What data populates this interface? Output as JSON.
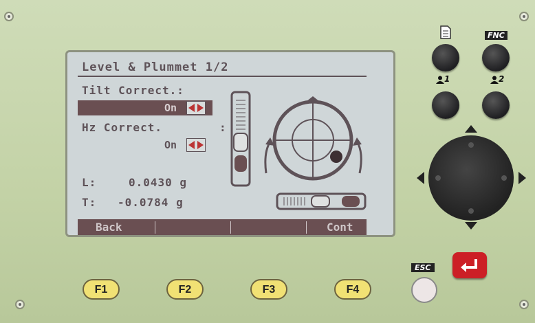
{
  "screen": {
    "title": "Level & Plummet 1/2",
    "tilt_label": "Tilt Correct.:",
    "tilt_value": "On",
    "hz_label": "Hz Correct.",
    "hz_colon": ":",
    "hz_value": "On",
    "l_label": "L:",
    "l_value": "0.0430 g",
    "t_label": "T:",
    "t_value": "-0.0784 g",
    "softkeys": [
      "Back",
      "",
      "",
      "Cont"
    ]
  },
  "keys": {
    "fnc_label": "FNC",
    "user1_label": "1",
    "user2_label": "2",
    "esc_label": "ESC",
    "f1": "F1",
    "f2": "F2",
    "f3": "F3",
    "f4": "F4"
  },
  "icons": [
    "page-icon",
    "user-icon",
    "enter-icon",
    "crosshair-level-icon",
    "vertical-bubble-icon",
    "horizontal-bubble-icon"
  ],
  "colors": {
    "device_body": "#c9d6b1",
    "lcd_ink": "#5e5258",
    "fkey": "#f1e174",
    "enter": "#cc1f26"
  }
}
